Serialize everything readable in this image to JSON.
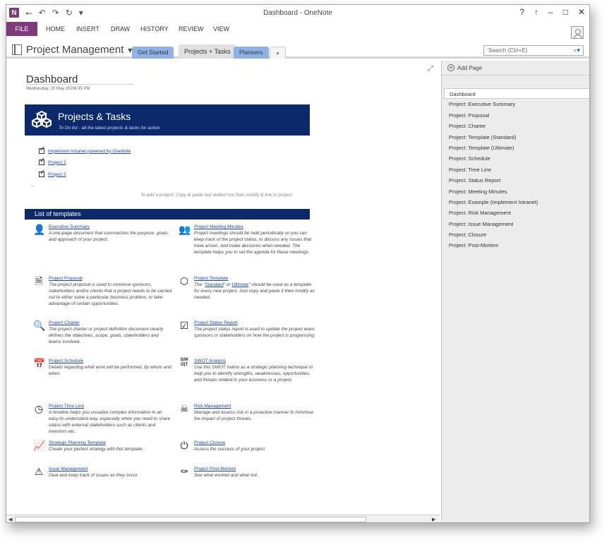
{
  "app": {
    "title": "Dashboard - OneNote",
    "logo_label": "N",
    "qat": [
      "back-icon",
      "undo-icon",
      "redo-icon",
      "repeat-icon",
      "customize-icon"
    ],
    "window_controls": {
      "help": "?",
      "ribbon_display": "↑",
      "minimize": "–",
      "maximize": "□",
      "close": "✕"
    }
  },
  "ribbon": {
    "tabs": [
      "FILE",
      "HOME",
      "INSERT",
      "DRAW",
      "HISTORY",
      "REVIEW",
      "VIEW"
    ]
  },
  "notebook": {
    "name": "Project Management",
    "dropdown_glyph": "▾",
    "sections": [
      {
        "label": "Get Started",
        "color": "#8fb2e6"
      },
      {
        "label": "Projects + Tasks",
        "color": "#d9d9d9"
      },
      {
        "label": "Planners",
        "color": "#8fb2e6"
      }
    ],
    "add_section": "+",
    "search": {
      "placeholder": "Search (Ctrl+E)"
    }
  },
  "page": {
    "title": "Dashboard",
    "date": "Wednesday, 20 May 2020",
    "time": "4:35 PM",
    "projects": {
      "title": "Projects & Tasks",
      "subtitle": "To Do list - all the latest projects & tasks for action",
      "items": [
        "Implement Intranet powered by OneNote",
        "Project 2",
        "Project 3"
      ],
      "dots": "...",
      "hint": "To add a project: Copy & paste last dotted row then modify & link to project"
    },
    "templates": {
      "title": "List of templates",
      "left": [
        {
          "name": "Executive Summary",
          "icon": "user-tie-icon",
          "glyph": "👤",
          "desc": "A one-page document that summarizes the purpose, goals, and approach of your project."
        },
        {
          "name": "Project Proposal",
          "icon": "document-icon",
          "glyph": "🗎",
          "desc": "The project proposal is used to convince sponsors, stakeholders and/or clients that a project needs to be carried out to either solve a particular business problem, or take advantage of certain opportunities."
        },
        {
          "name": "Project Charter",
          "icon": "document-search-icon",
          "glyph": "🔍",
          "desc": "The project charter or project definition document clearly defines the objectives, scope, goals, stakeholders and teams involved."
        },
        {
          "name": "Project Schedule",
          "icon": "calendar-icon",
          "glyph": "📅",
          "desc": "Details regarding what work will be performed, by whom and when."
        },
        {
          "name": "Project Time Line",
          "icon": "clock-icon",
          "glyph": "◷",
          "desc": "A timeline helps you visualize complex information in an easy-to-understand way, especially when you need to share status with external stakeholders such as clients and investors etc."
        },
        {
          "name": "Strategic Planning Template",
          "icon": "line-chart-icon",
          "glyph": "📈",
          "desc": "Create your perfect strategy with this template."
        },
        {
          "name": "Issue Management",
          "icon": "warning-icon",
          "glyph": "⚠",
          "desc": "Deal and keep track of issues as they occur."
        }
      ],
      "right": [
        {
          "name": "Project Meeting Minutes",
          "icon": "group-icon",
          "glyph": "👥",
          "desc": "Project meetings should be held periodically so you can keep track of the project status, to discuss any issues that have arisen, and make decisions when needed. The template helps you to set the agenda for these meetings."
        },
        {
          "name": "Project Template",
          "icon": "cube-icon",
          "glyph": "⬡",
          "desc_pre": "The \"",
          "desc_std": "Standard",
          "desc_mid": "\" or ",
          "desc_ult": "Ultimate",
          "desc_post": "\" should be used as a template for every new project. Just copy and paste it then modify as needed."
        },
        {
          "name": "Project Status Report",
          "icon": "checkbox-icon",
          "glyph": "☑",
          "desc": "The project status report is used to update the project team, sponsors or stakeholders on how the project is progressing."
        },
        {
          "name": "SWOT Analysis",
          "icon": "swot-icon",
          "glyph": "S|W O|T",
          "desc": "Use this SWOT matrix as a strategic planning technique to help you to identify strengths, weaknesses, opportunities, and threats related to your business or a project."
        },
        {
          "name": "Risk Management",
          "icon": "skull-icon",
          "glyph": "☠",
          "desc": "Manage and assess risk in a proactive manner to minimise the impact of project threats."
        },
        {
          "name": "Project Closure",
          "icon": "power-icon",
          "glyph": "⏻",
          "desc": "Assess the success of your project."
        },
        {
          "name": "Project Post-Mortem",
          "icon": "tombstone-icon",
          "glyph": "⚰",
          "desc": "See what worked and what not."
        }
      ]
    }
  },
  "pages_panel": {
    "add_page": "Add Page",
    "pages": [
      "Dashboard",
      "Project: Executive Summary",
      "Project: Proposal",
      "Project: Charter",
      "Project: Template (Standard)",
      "Project: Template (Ultimate)",
      "Project: Schedule",
      "Project: Time Line",
      "Project: Status Report",
      "Project: Meeting Minutes",
      "Project: Example (Implement Intranet)",
      "Project: Risk Management",
      "Project: Issue Management",
      "Project: Closure",
      "Project: Post-Mortem"
    ],
    "active_index": 0
  },
  "colors": {
    "accent": "#80397b",
    "header_navy": "#0c2a6b",
    "link": "#1c45b4"
  }
}
